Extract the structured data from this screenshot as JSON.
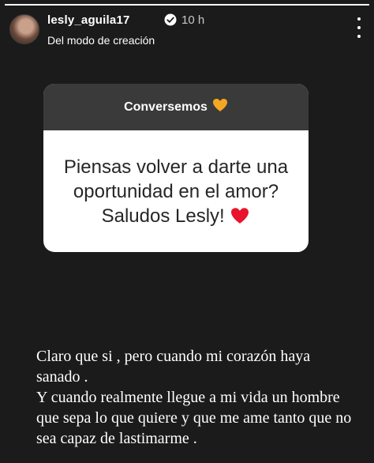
{
  "story": {
    "progress": 1.0
  },
  "header": {
    "username": "lesly_aguila17",
    "time": "10 h",
    "subtitle": "Del modo de creación"
  },
  "card": {
    "title": "Conversemos",
    "question": "Piensas volver a darte una oportunidad en el amor? Saludos Lesly!"
  },
  "reply": {
    "paragraph1": "Claro que si , pero cuando mi corazón haya sanado .",
    "paragraph2": "Y cuando realmente llegue a mi vida un hombre que sepa lo que quiere y que me ame tanto que no sea capaz de lastimarme ."
  },
  "colors": {
    "background": "#1b1b1b",
    "verified": "#3897f0",
    "heart_orange": "#f5a623",
    "heart_red": "#e8132d"
  }
}
